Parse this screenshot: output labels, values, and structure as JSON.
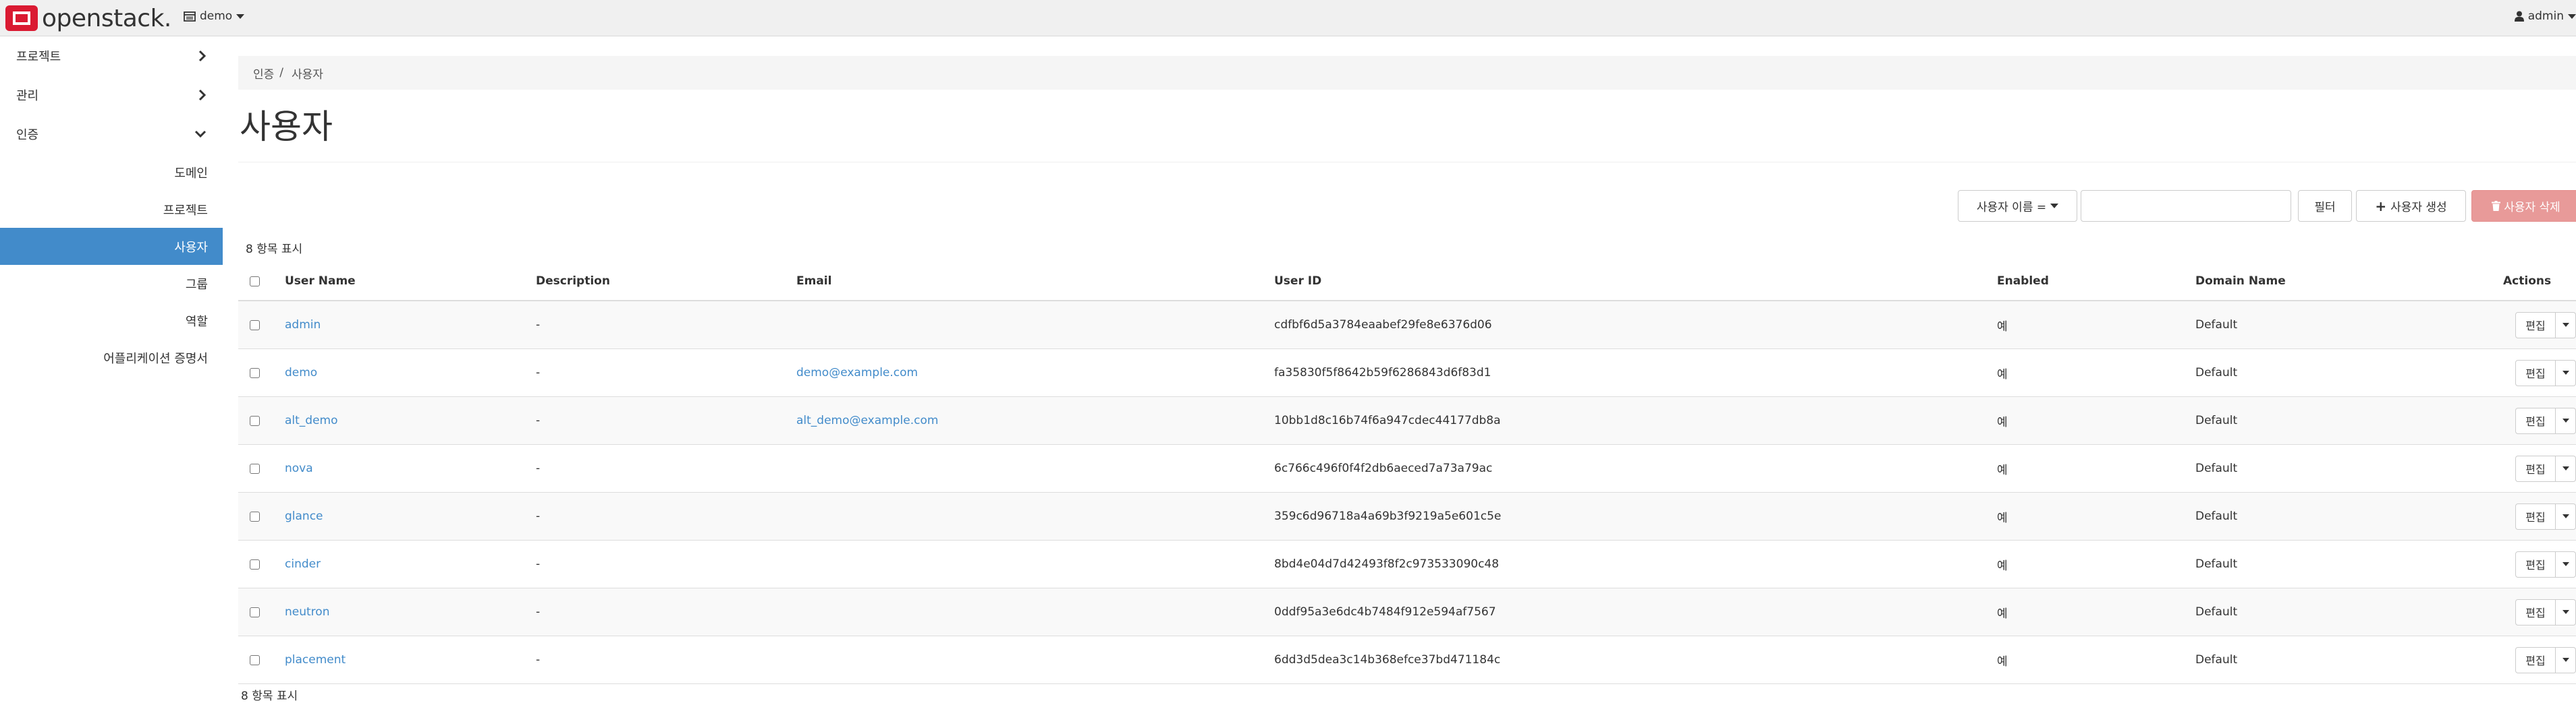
{
  "navbar": {
    "brand": "openstack.",
    "project": "demo",
    "user": "admin"
  },
  "sidebar": {
    "groups": [
      {
        "label": "프로젝트",
        "expanded": false
      },
      {
        "label": "관리",
        "expanded": false
      },
      {
        "label": "인증",
        "expanded": true
      }
    ],
    "items": [
      {
        "label": "도메인",
        "active": false
      },
      {
        "label": "프로젝트",
        "active": false
      },
      {
        "label": "사용자",
        "active": true
      },
      {
        "label": "그룹",
        "active": false
      },
      {
        "label": "역할",
        "active": false
      },
      {
        "label": "어플리케이션 증명서",
        "active": false
      }
    ]
  },
  "breadcrumb": {
    "parent": "인증",
    "separator": "/",
    "current": "사용자"
  },
  "page": {
    "title": "사용자"
  },
  "toolbar": {
    "filter_field": "사용자 이름 =",
    "filter_value": "",
    "filter_button": "필터",
    "create_button": "사용자 생성",
    "delete_button": "사용자 삭제"
  },
  "table": {
    "count_text": "8 항목 표시",
    "count_bottom": "8 항목 표시",
    "columns": [
      "User Name",
      "Description",
      "Email",
      "User ID",
      "Enabled",
      "Domain Name",
      "Actions"
    ],
    "edit_label": "편집",
    "rows": [
      {
        "name": "admin",
        "description": "-",
        "email": "",
        "user_id": "cdfbf6d5a3784eaabef29fe8e6376d06",
        "enabled": "예",
        "domain": "Default"
      },
      {
        "name": "demo",
        "description": "-",
        "email": "demo@example.com",
        "user_id": "fa35830f5f8642b59f6286843d6f83d1",
        "enabled": "예",
        "domain": "Default"
      },
      {
        "name": "alt_demo",
        "description": "-",
        "email": "alt_demo@example.com",
        "user_id": "10bb1d8c16b74f6a947cdec44177db8a",
        "enabled": "예",
        "domain": "Default"
      },
      {
        "name": "nova",
        "description": "-",
        "email": "",
        "user_id": "6c766c496f0f4f2db6aeced7a73a79ac",
        "enabled": "예",
        "domain": "Default"
      },
      {
        "name": "glance",
        "description": "-",
        "email": "",
        "user_id": "359c6d96718a4a69b3f9219a5e601c5e",
        "enabled": "예",
        "domain": "Default"
      },
      {
        "name": "cinder",
        "description": "-",
        "email": "",
        "user_id": "8bd4e04d7d42493f8f2c973533090c48",
        "enabled": "예",
        "domain": "Default"
      },
      {
        "name": "neutron",
        "description": "-",
        "email": "",
        "user_id": "0ddf95a3e6dc4b7484f912e594af7567",
        "enabled": "예",
        "domain": "Default"
      },
      {
        "name": "placement",
        "description": "-",
        "email": "",
        "user_id": "6dd3d5dea3c14b368efce37bd471184c",
        "enabled": "예",
        "domain": "Default"
      }
    ]
  },
  "colors": {
    "brand_red": "#da1a32",
    "active_blue": "#428bca",
    "link": "#428bca",
    "danger": "#e89a99"
  }
}
